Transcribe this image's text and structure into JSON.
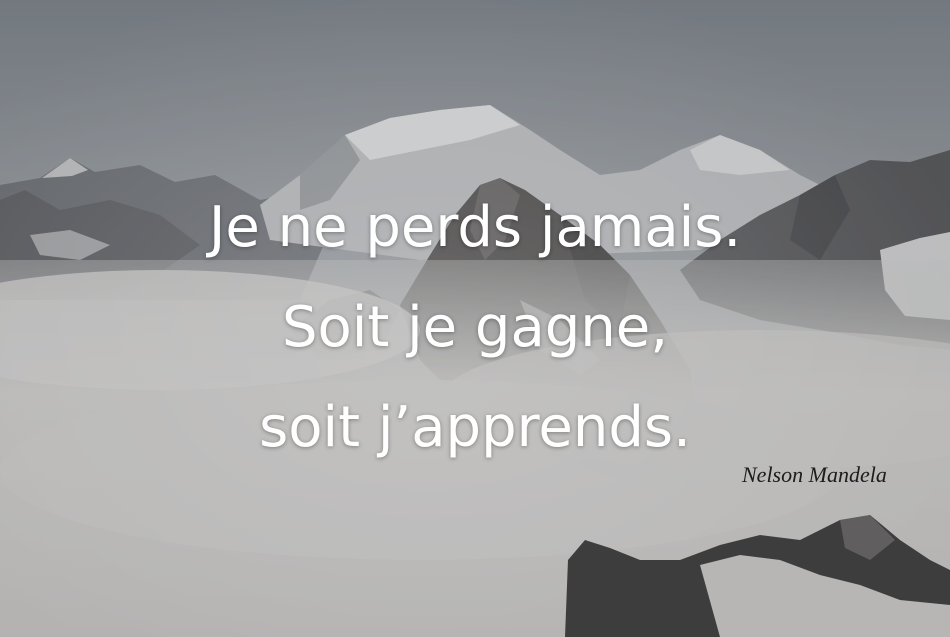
{
  "quote": {
    "lines": [
      "Je ne perds jamais.",
      "Soit je gagne,",
      "soit j’apprends."
    ]
  },
  "author": "Nelson Mandela",
  "colors": {
    "sky": "#8e969d",
    "fog": "#d6d5d2",
    "rock": "#4a4846",
    "snow": "#e4e3e1",
    "quote_text": "#ffffff",
    "author_text": "#1c1c1c"
  }
}
